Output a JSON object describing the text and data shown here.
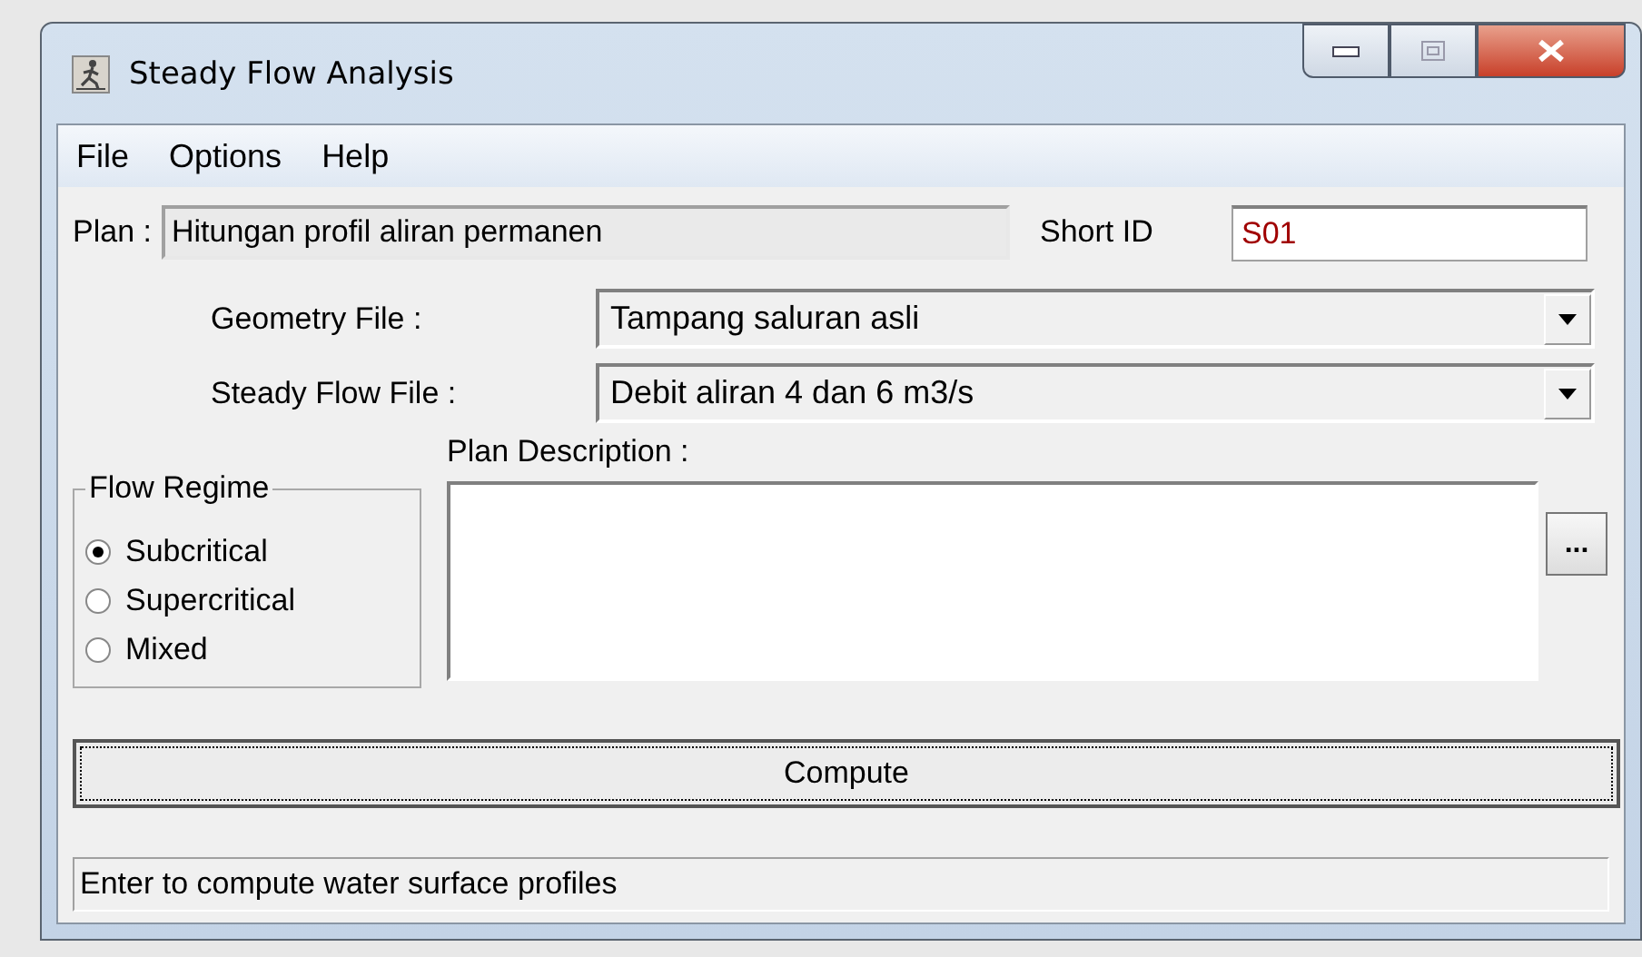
{
  "window": {
    "title": "Steady Flow Analysis"
  },
  "menu": [
    "File",
    "Options",
    "Help"
  ],
  "plan": {
    "label": "Plan :",
    "value": "Hitungan profil aliran permanen"
  },
  "short_id": {
    "label": "Short ID",
    "value": "S01"
  },
  "dropdowns": [
    {
      "label": "Geometry File :",
      "value": "Tampang saluran asli"
    },
    {
      "label": "Steady Flow File :",
      "value": "Debit aliran 4 dan 6 m3/s"
    }
  ],
  "flow_regime": {
    "title": "Flow Regime",
    "options": [
      {
        "label": "Subcritical",
        "selected": true
      },
      {
        "label": "Supercritical",
        "selected": false
      },
      {
        "label": "Mixed",
        "selected": false
      }
    ]
  },
  "plan_description": {
    "label": "Plan Description :",
    "browse_button": "..."
  },
  "compute_button": "Compute",
  "status_bar": "Enter to compute water surface profiles"
}
